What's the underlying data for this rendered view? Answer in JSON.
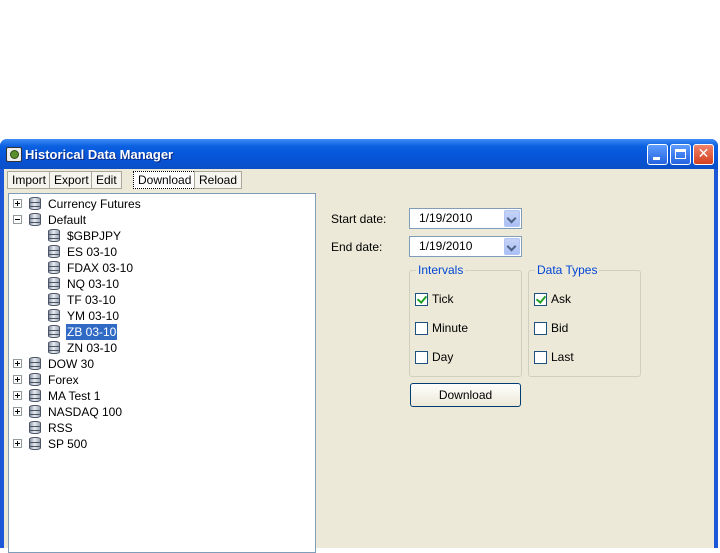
{
  "window": {
    "title": "Historical Data Manager"
  },
  "toolbar": [
    "Import",
    "Export",
    "Edit",
    "Download",
    "Reload"
  ],
  "tree": [
    {
      "label": "Currency Futures",
      "expander": "plus",
      "level": 0
    },
    {
      "label": "Default",
      "expander": "minus",
      "level": 0
    },
    {
      "label": "$GBPJPY",
      "expander": "none",
      "level": 1
    },
    {
      "label": "ES 03-10",
      "expander": "none",
      "level": 1
    },
    {
      "label": "FDAX 03-10",
      "expander": "none",
      "level": 1
    },
    {
      "label": "NQ 03-10",
      "expander": "none",
      "level": 1
    },
    {
      "label": "TF 03-10",
      "expander": "none",
      "level": 1
    },
    {
      "label": "YM 03-10",
      "expander": "none",
      "level": 1
    },
    {
      "label": "ZB 03-10",
      "expander": "none",
      "level": 1,
      "selected": true
    },
    {
      "label": "ZN 03-10",
      "expander": "none",
      "level": 1
    },
    {
      "label": "DOW 30",
      "expander": "plus",
      "level": 0
    },
    {
      "label": "Forex",
      "expander": "plus",
      "level": 0
    },
    {
      "label": "MA Test 1",
      "expander": "plus",
      "level": 0
    },
    {
      "label": "NASDAQ 100",
      "expander": "plus",
      "level": 0
    },
    {
      "label": "RSS",
      "expander": "none",
      "level": 0
    },
    {
      "label": "SP 500",
      "expander": "plus",
      "level": 0
    }
  ],
  "form": {
    "start_label": "Start date:",
    "start_value": "1/19/2010",
    "end_label": "End date:",
    "end_value": "1/19/2010",
    "intervals_title": "Intervals",
    "intervals": [
      {
        "label": "Tick",
        "checked": true
      },
      {
        "label": "Minute",
        "checked": false
      },
      {
        "label": "Day",
        "checked": false
      }
    ],
    "datatypes_title": "Data Types",
    "datatypes": [
      {
        "label": "Ask",
        "checked": true
      },
      {
        "label": "Bid",
        "checked": false
      },
      {
        "label": "Last",
        "checked": false
      }
    ],
    "download_label": "Download"
  }
}
